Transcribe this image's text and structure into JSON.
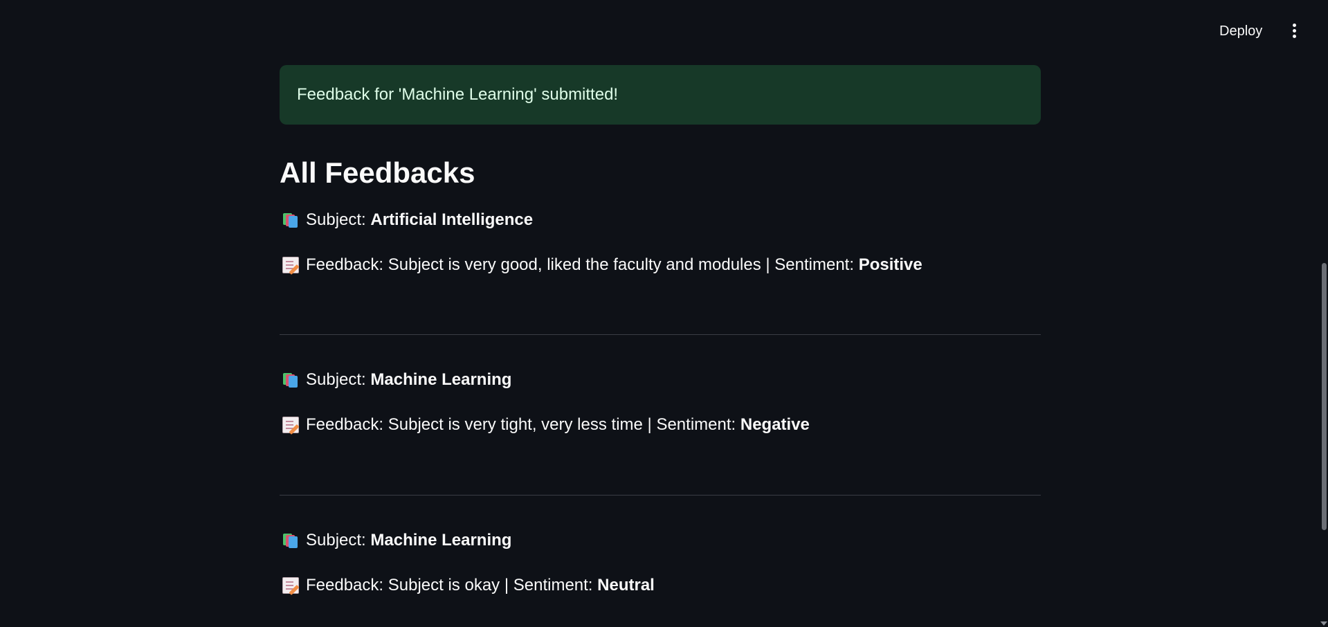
{
  "header": {
    "deploy_label": "Deploy",
    "menu_icon": "vertical-dots-icon"
  },
  "alert": {
    "text": "Feedback for 'Machine Learning' submitted!",
    "color": "#173928"
  },
  "section": {
    "title": "All Feedbacks"
  },
  "feedbacks": [
    {
      "subject_label": "Subject: ",
      "subject": "Artificial Intelligence",
      "feedback_label": "Feedback: ",
      "feedback": "Subject is very good, liked the faculty and modules",
      "sentiment_label": " | Sentiment: ",
      "sentiment": "Positive"
    },
    {
      "subject_label": "Subject: ",
      "subject": "Machine Learning",
      "feedback_label": "Feedback: ",
      "feedback": "Subject is very tight, very less time",
      "sentiment_label": " | Sentiment: ",
      "sentiment": "Negative"
    },
    {
      "subject_label": "Subject: ",
      "subject": "Machine Learning",
      "feedback_label": "Feedback: ",
      "feedback": "Subject is okay",
      "sentiment_label": " | Sentiment: ",
      "sentiment": "Neutral"
    }
  ]
}
